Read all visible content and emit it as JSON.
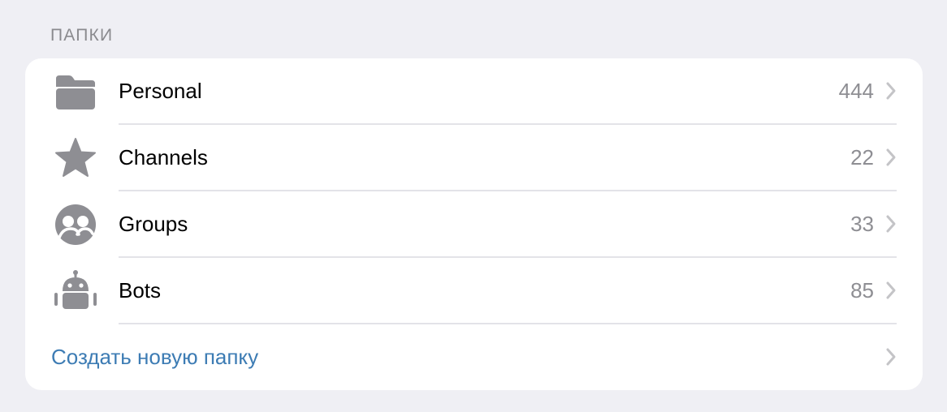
{
  "section": {
    "title": "ПАПКИ"
  },
  "folders": [
    {
      "label": "Personal",
      "count": "444",
      "icon": "folder-icon"
    },
    {
      "label": "Channels",
      "count": "22",
      "icon": "star-icon"
    },
    {
      "label": "Groups",
      "count": "33",
      "icon": "group-icon"
    },
    {
      "label": "Bots",
      "count": "85",
      "icon": "bot-icon"
    }
  ],
  "create_folder": {
    "label": "Создать новую папку"
  },
  "colors": {
    "background": "#efeff4",
    "card": "#ffffff",
    "icon": "#8e8e93",
    "accent_link": "#3d7cb4",
    "chevron": "#c4c4c7"
  }
}
